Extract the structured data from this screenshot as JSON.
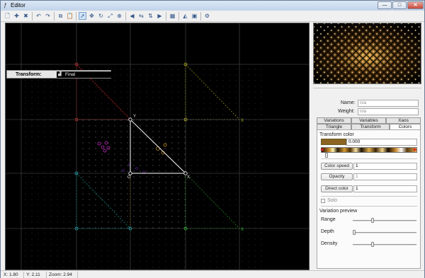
{
  "window": {
    "title": "Editor"
  },
  "controls": {
    "minimize": "—",
    "maximize": "□",
    "close": "✕"
  },
  "toolbar": [
    {
      "name": "new-icon",
      "glyph": "🗋",
      "on": false
    },
    {
      "name": "add-icon",
      "glyph": "✚",
      "on": false
    },
    {
      "name": "delete-icon",
      "glyph": "✖",
      "on": false
    },
    {
      "name": "undo-icon",
      "glyph": "↶",
      "on": false
    },
    {
      "name": "redo-icon",
      "glyph": "↷",
      "on": false
    },
    {
      "name": "copy-icon",
      "glyph": "⧉",
      "on": false
    },
    {
      "name": "paste-icon",
      "glyph": "📋",
      "on": false
    },
    {
      "name": "select-icon",
      "glyph": "➚",
      "on": true
    },
    {
      "name": "move-icon",
      "glyph": "✥",
      "on": false
    },
    {
      "name": "rotate-icon",
      "glyph": "↻",
      "on": false
    },
    {
      "name": "scale-icon",
      "glyph": "⤢",
      "on": false
    },
    {
      "name": "pivot-icon",
      "glyph": "⊕",
      "on": false
    },
    {
      "name": "flip-left-icon",
      "glyph": "◀",
      "on": false
    },
    {
      "name": "flip-h-icon",
      "glyph": "⇆",
      "on": false
    },
    {
      "name": "flip-v-icon",
      "glyph": "⇅",
      "on": false
    },
    {
      "name": "flip-right-icon",
      "glyph": "▶",
      "on": false
    },
    {
      "name": "grid-icon",
      "glyph": "▦",
      "on": false
    },
    {
      "name": "triangle-icon",
      "glyph": "◭",
      "on": false
    },
    {
      "name": "image-icon",
      "glyph": "▣",
      "on": false
    },
    {
      "name": "settings-icon",
      "glyph": "⚙",
      "on": false
    }
  ],
  "transform": {
    "label": "Transform:",
    "value": "Final",
    "icon": "chart-icon"
  },
  "fields": {
    "name_label": "Name:",
    "name_value": "n/a",
    "weight_label": "Weight:",
    "weight_value": "n/a"
  },
  "tabs_row1": [
    "Variations",
    "Variables",
    "Xaos"
  ],
  "tabs_row2": [
    "Triangle",
    "Transform",
    "Colors"
  ],
  "active_tab": "Colors",
  "colors": {
    "section_label": "Transform color",
    "swatch_color": "#8a6420",
    "color_value": "0.000",
    "color_speed_label": "Color speed",
    "color_speed_value": "1",
    "opacity_label": "Opacity",
    "opacity_value": "1",
    "direct_color_label": "Direct color",
    "direct_color_value": "1",
    "solo_label": "Solo",
    "solo_checked": false
  },
  "variation_preview": {
    "label": "Variation preview",
    "range_label": "Range",
    "range_level": 0.3,
    "depth_label": "Depth",
    "depth_level": 0.0,
    "density_label": "Density",
    "density_level": 0.3
  },
  "status": {
    "x": "X: 1.80",
    "y": "Y: 2.11",
    "zoom": "Zoom: 2.94"
  },
  "canvas_labels": {
    "X": "X",
    "Y": "Y",
    "O": "O"
  }
}
